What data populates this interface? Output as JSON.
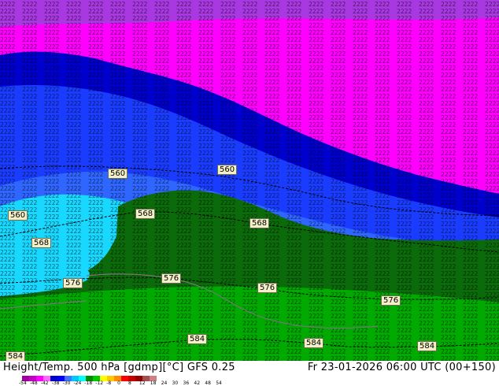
{
  "title": "Height/Temp. 500 hPa [gdmp][°C] GFS 0.25",
  "valid_time": "Fr 23-01-2026 06:00 UTC (00+150)",
  "contour_labels": [
    "560",
    "560",
    "560",
    "568",
    "568",
    "568",
    "576",
    "576",
    "576",
    "576",
    "584",
    "584",
    "584",
    "584"
  ],
  "scale": {
    "ticks": [
      "-54",
      "-48",
      "-42",
      "-38",
      "-30",
      "-24",
      "-18",
      "-12",
      "-8",
      "0",
      "8",
      "12",
      "18",
      "24",
      "30",
      "36",
      "42",
      "48",
      "54"
    ],
    "colors": [
      "#9e009e",
      "#c400c4",
      "#ff00ff",
      "#ff66ff",
      "#0000c8",
      "#0000ff",
      "#3c78ff",
      "#00c8ff",
      "#00ffff",
      "#008c00",
      "#00c800",
      "#ffff00",
      "#ffc800",
      "#ff8c00",
      "#ff0000",
      "#c80000",
      "#960000",
      "#a05050",
      "#d08080"
    ]
  },
  "colors": {
    "magenta": "#ff00ff",
    "purple": "#9b1fd0",
    "deep_blue": "#0000cc",
    "blue": "#1a3cff",
    "cyan": "#18d8ff",
    "dark_green": "#0b6b0b",
    "green": "#00aa00"
  }
}
